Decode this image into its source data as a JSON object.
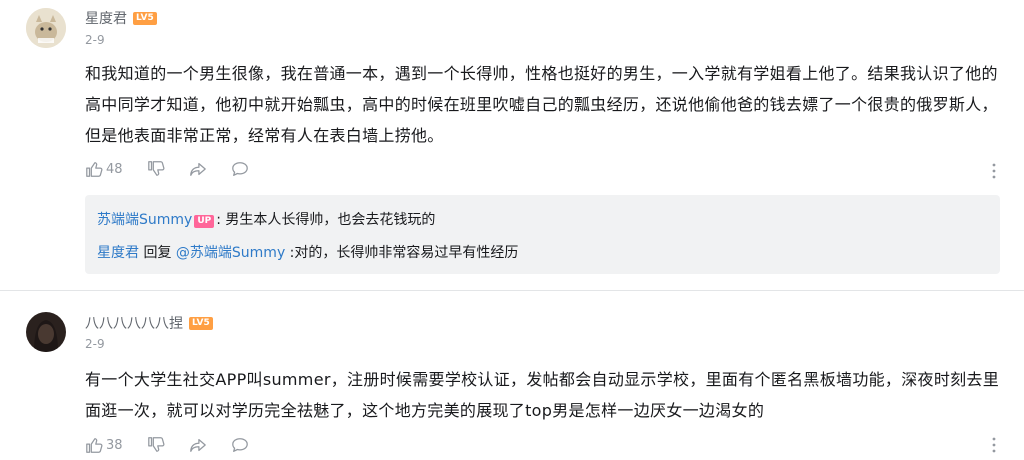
{
  "comments": [
    {
      "username": "星度君",
      "level": "LV5",
      "date": "2-9",
      "content": "和我知道的一个男生很像，我在普通一本，遇到一个长得帅，性格也挺好的男生，一入学就有学姐看上他了。结果我认识了他的高中同学才知道，他初中就开始瓢虫，高中的时候在班里吹嘘自己的瓢虫经历，还说他偷他爸的钱去嫖了一个很贵的俄罗斯人，但是他表面非常正常，经常有人在表白墙上捞他。",
      "likes": "48",
      "replies": [
        {
          "author": "苏端端Summy",
          "badge": "UP",
          "separator": ": ",
          "text": "男生本人长得帅，也会去花钱玩的"
        },
        {
          "author": "星度君",
          "reply_word": " 回复 ",
          "mention": "@苏端端Summy",
          "text": " :对的，长得帅非常容易过早有性经历"
        }
      ]
    },
    {
      "username": "八八八八八八捏",
      "level": "LV5",
      "date": "2-9",
      "content": "有一个大学生社交APP叫summer，注册时候需要学校认证，发帖都会自动显示学校，里面有个匿名黑板墙功能，深夜时刻去里面逛一次，就可以对学历完全祛魅了，这个地方完美的展现了top男是怎样一边厌女一边渴女的",
      "likes": "38"
    }
  ],
  "icons": [
    "like-icon",
    "dislike-icon",
    "share-icon",
    "comment-icon",
    "more-icon"
  ],
  "colors": {
    "link": "#2e7ac8",
    "level_badge": "#ff9f43",
    "up_badge": "#ff6699",
    "muted": "#9499a0"
  }
}
